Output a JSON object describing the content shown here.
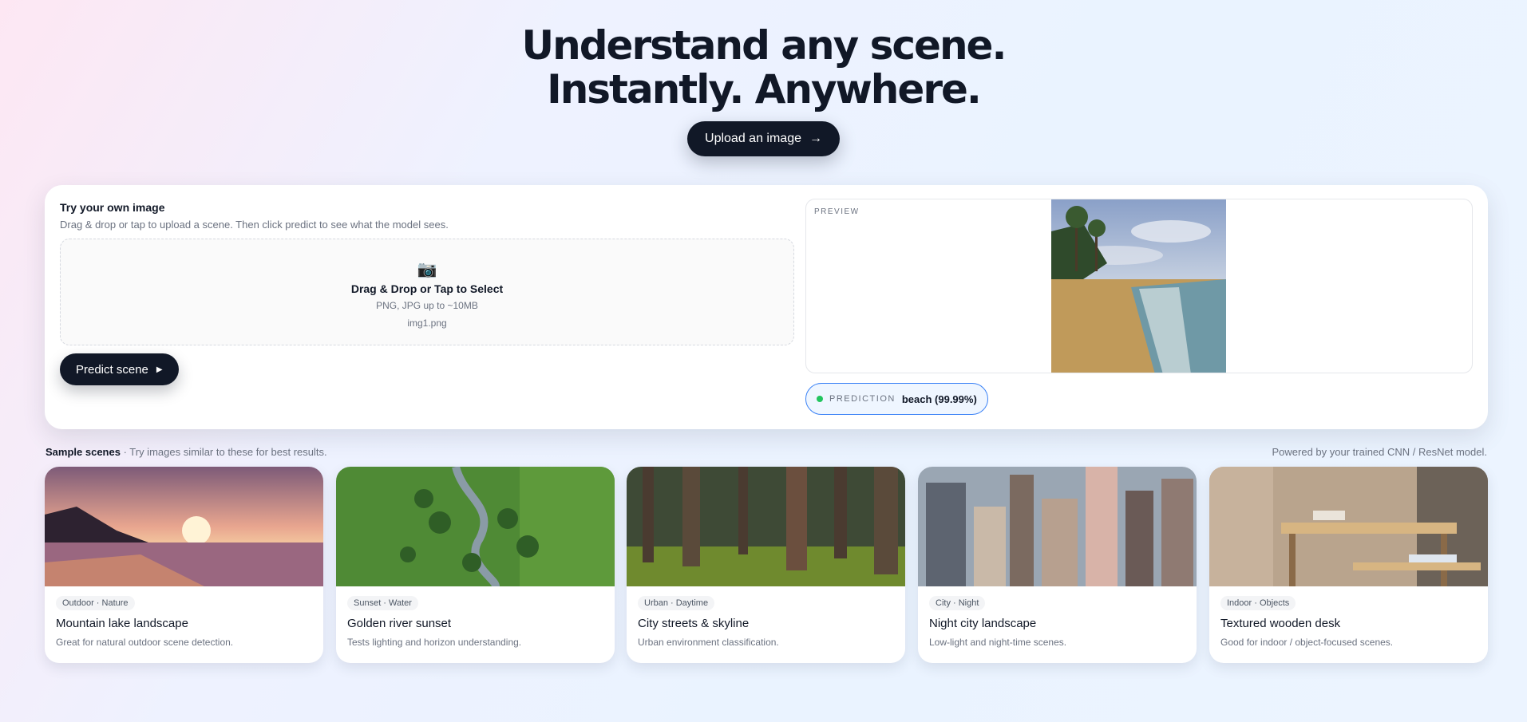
{
  "hero": {
    "line1": "Understand any scene.",
    "line2": "Instantly. Anywhere.",
    "upload_label": "Upload an image",
    "upload_arrow": "→"
  },
  "upload": {
    "title": "Try your own image",
    "subtitle": "Drag & drop or tap to upload a scene. Then click predict to see what the model sees.",
    "dropzone_icon": "camera-icon",
    "dropzone_title": "Drag & Drop or Tap to Select",
    "dropzone_hint": "PNG, JPG up to ~10MB",
    "filename": "img1.png",
    "predict_label": "Predict scene"
  },
  "preview": {
    "label": "PREVIEW",
    "prediction_label": "PREDICTION",
    "prediction_value": "beach (99.99%)",
    "status_color": "#22c55e"
  },
  "samples": {
    "heading": "Sample scenes",
    "subheading": "· Try images similar to these for best results.",
    "powered_by": "Powered by your trained CNN / ResNet model.",
    "cards": [
      {
        "tag": "Outdoor · Nature",
        "title": "Mountain lake landscape",
        "desc": "Great for natural outdoor scene detection."
      },
      {
        "tag": "Sunset · Water",
        "title": "Golden river sunset",
        "desc": "Tests lighting and horizon understanding."
      },
      {
        "tag": "Urban · Daytime",
        "title": "City streets & skyline",
        "desc": "Urban environment classification."
      },
      {
        "tag": "City · Night",
        "title": "Night city landscape",
        "desc": "Low-light and night-time scenes."
      },
      {
        "tag": "Indoor · Objects",
        "title": "Textured wooden desk",
        "desc": "Good for indoor / object-focused scenes."
      }
    ]
  },
  "colors": {
    "primary": "#111827",
    "accent": "#3b82f6"
  }
}
